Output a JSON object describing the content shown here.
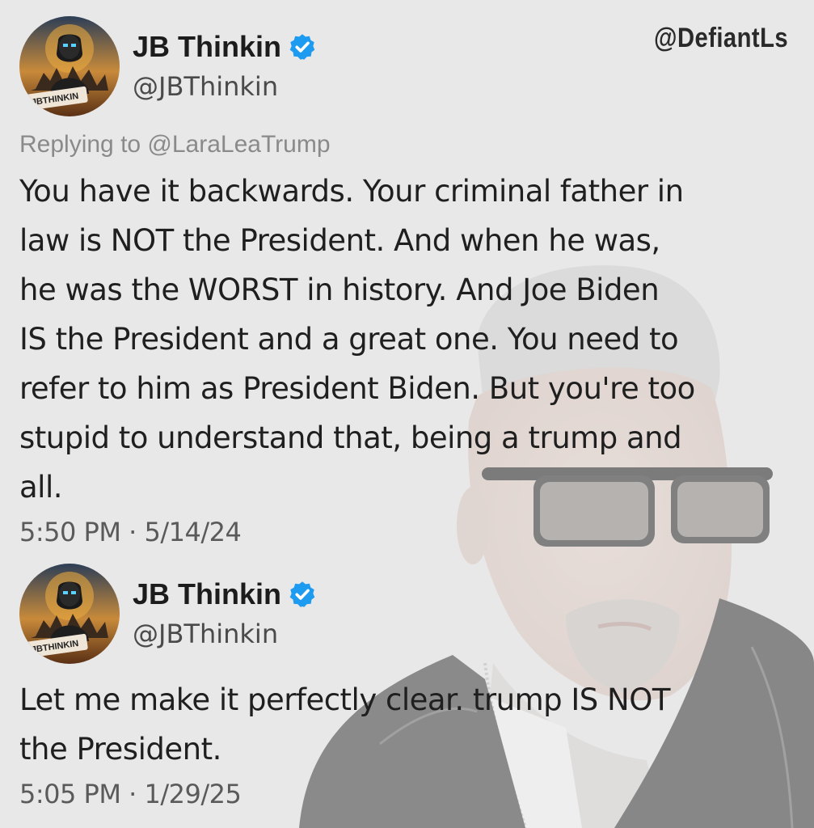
{
  "watermark": "@DefiantLs",
  "tweets": [
    {
      "display_name": "JB Thinkin",
      "handle": "@JBThinkin",
      "avatar_label": "JBTHINKIN",
      "replying_to": "Replying to @LaraLeaTrump",
      "lines": [
        "You have it backwards. Your criminal father in",
        "law is NOT the President. And when he was,",
        "he was the WORST in history. And Joe Biden",
        "IS the President and a great one. You need to",
        "refer to him as President Biden. But you're too",
        "stupid to understand that, being a trump and",
        "all."
      ],
      "timestamp": "5:50 PM · 5/14/24"
    },
    {
      "display_name": "JB Thinkin",
      "handle": "@JBThinkin",
      "avatar_label": "JBTHINKIN",
      "lines": [
        "Let me make it perfectly clear. trump IS NOT",
        "the President."
      ],
      "timestamp": "5:05 PM · 1/29/25"
    }
  ],
  "colors": {
    "verified": "#1d9bf0",
    "background": "#e8e8e8",
    "text": "#1f1f1f",
    "muted": "#8a8a8a"
  }
}
